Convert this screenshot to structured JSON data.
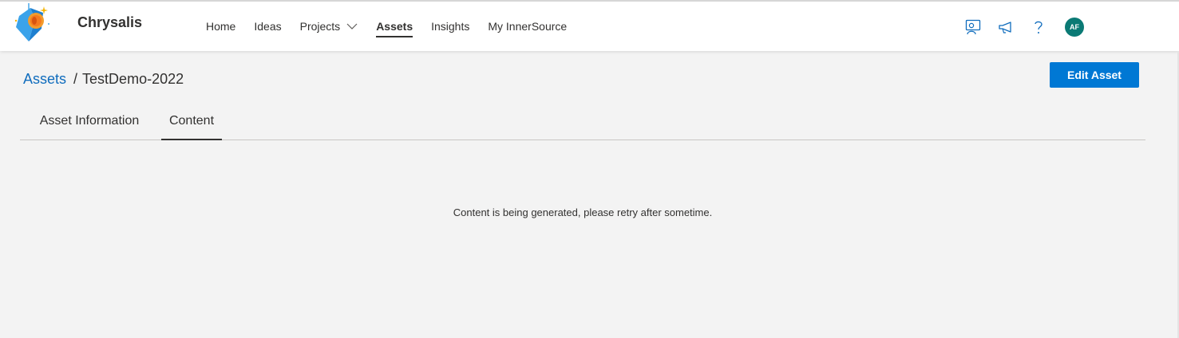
{
  "app": {
    "name": "Chrysalis",
    "logo_icon": "chrysalis-logo-icon"
  },
  "nav": {
    "items": [
      {
        "label": "Home",
        "active": false
      },
      {
        "label": "Ideas",
        "active": false
      },
      {
        "label": "Projects",
        "active": false,
        "has_dropdown": true
      },
      {
        "label": "Assets",
        "active": true
      },
      {
        "label": "Insights",
        "active": false
      },
      {
        "label": "My InnerSource",
        "active": false
      }
    ]
  },
  "header_icons": {
    "feedback": "feedback-icon",
    "announcements": "megaphone-icon",
    "help": "help-icon",
    "avatar_initials": "AF",
    "avatar_color": "#0b7a75"
  },
  "breadcrumb": {
    "parent": "Assets",
    "separator": "/",
    "current": "TestDemo-2022"
  },
  "actions": {
    "edit_label": "Edit Asset",
    "accent": "#0078d4"
  },
  "tabs": [
    {
      "label": "Asset Information",
      "active": false
    },
    {
      "label": "Content",
      "active": true
    }
  ],
  "content": {
    "message": "Content is being generated, please retry after sometime."
  }
}
